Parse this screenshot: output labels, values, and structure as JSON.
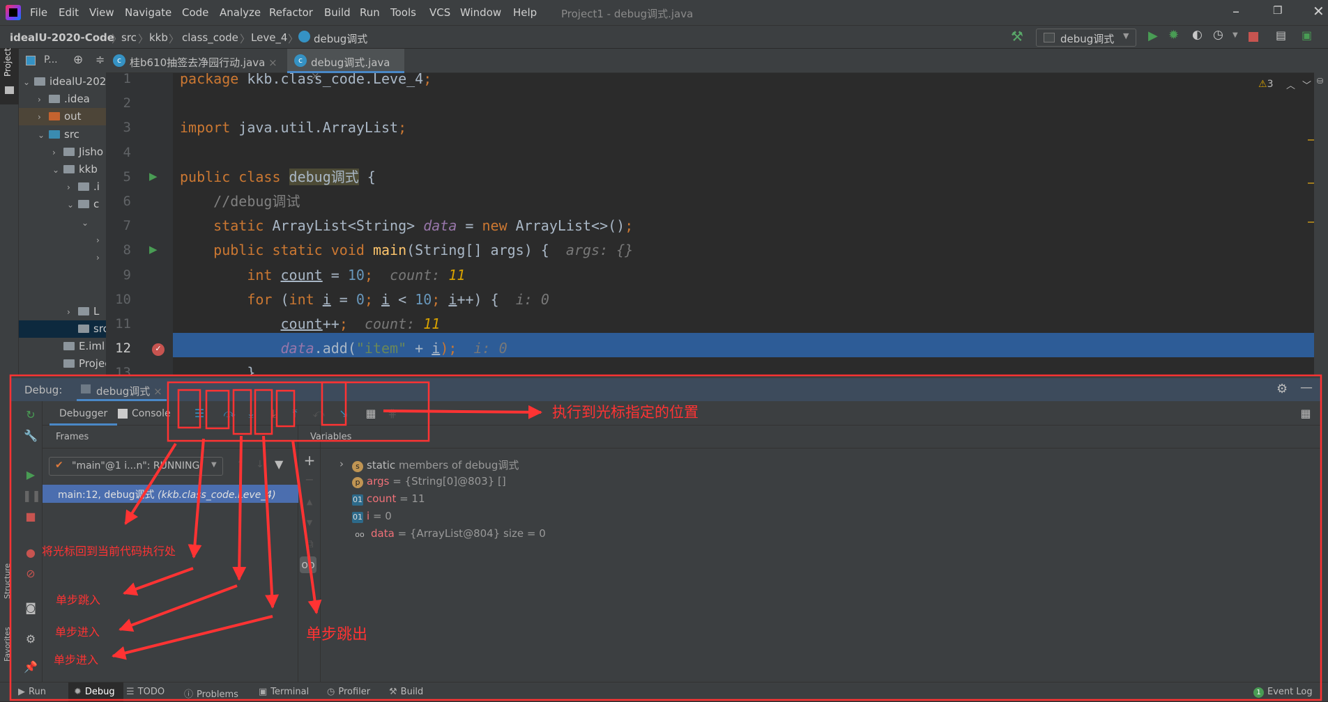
{
  "window": {
    "title": "Project1 - debug调式.java",
    "menu": [
      "File",
      "Edit",
      "View",
      "Navigate",
      "Code",
      "Analyze",
      "Refactor",
      "Build",
      "Run",
      "Tools",
      "VCS",
      "Window",
      "Help"
    ]
  },
  "breadcrumb": [
    "idealU-2020-Code",
    "src",
    "kkb",
    "class_code",
    "Leve_4",
    "debug调式"
  ],
  "run_config": "debug调式",
  "warnings": "3",
  "tabs": [
    {
      "label": "桂b610抽签去净园行动.java"
    },
    {
      "label": "debug调式.java"
    }
  ],
  "project": {
    "panel_label": "P...",
    "stripe_label": "Project",
    "items": [
      {
        "label": "idealU-202",
        "indent": 0,
        "arrow": "v",
        "kind": "module"
      },
      {
        "label": ".idea",
        "indent": 1,
        "arrow": ">",
        "kind": "folder"
      },
      {
        "label": "out",
        "indent": 1,
        "arrow": ">",
        "kind": "out"
      },
      {
        "label": "src",
        "indent": 1,
        "arrow": "v",
        "kind": "src"
      },
      {
        "label": "Jisho",
        "indent": 2,
        "arrow": ">",
        "kind": "pkg"
      },
      {
        "label": "kkb",
        "indent": 2,
        "arrow": "v",
        "kind": "pkg"
      },
      {
        "label": ".i",
        "indent": 3,
        "arrow": ">",
        "kind": "folder"
      },
      {
        "label": "c",
        "indent": 3,
        "arrow": "v",
        "kind": "pkg"
      },
      {
        "label": "",
        "indent": 4,
        "arrow": "v",
        "kind": "none"
      },
      {
        "label": "",
        "indent": 5,
        "arrow": ">",
        "kind": "none"
      },
      {
        "label": "",
        "indent": 5,
        "arrow": ">",
        "kind": "none"
      },
      {
        "label": "L",
        "indent": 3,
        "arrow": ">",
        "kind": "pkg"
      },
      {
        "label": "src.iml",
        "indent": 3,
        "arrow": "",
        "kind": "file"
      },
      {
        "label": "E.iml",
        "indent": 2,
        "arrow": "",
        "kind": "file"
      },
      {
        "label": "Project",
        "indent": 2,
        "arrow": "",
        "kind": "file"
      }
    ]
  },
  "code": {
    "current_line": 12,
    "breakpoint_line": 12,
    "lines": [
      [
        {
          "t": "package ",
          "c": "k"
        },
        {
          "t": "kkb.class_code.Leve_4",
          "c": ""
        },
        {
          "t": ";",
          "c": "k"
        }
      ],
      [],
      [
        {
          "t": "import ",
          "c": "k"
        },
        {
          "t": "java.util.ArrayList",
          "c": ""
        },
        {
          "t": ";",
          "c": "k"
        }
      ],
      [],
      [
        {
          "t": "public class ",
          "c": "k"
        },
        {
          "t": "debug调式",
          "c": "cls"
        },
        {
          "t": " {",
          "c": ""
        }
      ],
      [
        {
          "t": "    //debug调试",
          "c": "c"
        }
      ],
      [
        {
          "t": "    static ",
          "c": "k"
        },
        {
          "t": "ArrayList<String> ",
          "c": ""
        },
        {
          "t": "data",
          "c": "f"
        },
        {
          "t": " = ",
          "c": ""
        },
        {
          "t": "new ",
          "c": "k"
        },
        {
          "t": "ArrayList<>()",
          "c": ""
        },
        {
          "t": ";",
          "c": "k"
        }
      ],
      [
        {
          "t": "    public static void ",
          "c": "k"
        },
        {
          "t": "main",
          "c": "m"
        },
        {
          "t": "(String[] args) {  ",
          "c": ""
        },
        {
          "t": "args: {}",
          "c": "h"
        }
      ],
      [
        {
          "t": "        int ",
          "c": "k"
        },
        {
          "t": "count",
          "c": "u"
        },
        {
          "t": " = ",
          "c": ""
        },
        {
          "t": "10",
          "c": "n"
        },
        {
          "t": ";  ",
          "c": "k"
        },
        {
          "t": "count: ",
          "c": "h"
        },
        {
          "t": "11",
          "c": "hv"
        }
      ],
      [
        {
          "t": "        for ",
          "c": "k"
        },
        {
          "t": "(",
          "c": ""
        },
        {
          "t": "int ",
          "c": "k"
        },
        {
          "t": "i",
          "c": "u"
        },
        {
          "t": " = ",
          "c": ""
        },
        {
          "t": "0",
          "c": "n"
        },
        {
          "t": "; ",
          "c": "k"
        },
        {
          "t": "i",
          "c": "u"
        },
        {
          "t": " < ",
          "c": ""
        },
        {
          "t": "10",
          "c": "n"
        },
        {
          "t": "; ",
          "c": "k"
        },
        {
          "t": "i",
          "c": "u"
        },
        {
          "t": "++) {  ",
          "c": ""
        },
        {
          "t": "i: 0",
          "c": "h"
        }
      ],
      [
        {
          "t": "            ",
          "c": ""
        },
        {
          "t": "count",
          "c": "u"
        },
        {
          "t": "++",
          "c": ""
        },
        {
          "t": ";  ",
          "c": "k"
        },
        {
          "t": "count: ",
          "c": "h"
        },
        {
          "t": "11",
          "c": "hv"
        }
      ],
      [
        {
          "t": "            ",
          "c": ""
        },
        {
          "t": "data",
          "c": "f"
        },
        {
          "t": ".add(",
          "c": ""
        },
        {
          "t": "\"item\"",
          "c": "s"
        },
        {
          "t": " + ",
          "c": ""
        },
        {
          "t": "i",
          "c": "u"
        },
        {
          "t": ");  ",
          "c": "k"
        },
        {
          "t": "i: 0",
          "c": "h"
        }
      ],
      [
        {
          "t": "        }",
          "c": ""
        }
      ]
    ]
  },
  "debug": {
    "label": "Debug:",
    "session": "debug调式",
    "tabs": [
      "Debugger",
      "Console"
    ],
    "frames_label": "Frames",
    "variables_label": "Variables",
    "thread": "\"main\"@1 i...n\": RUNNING",
    "frame": "main:12, debug调式",
    "frame_pkg": "(kkb.class_code.Leve_4)",
    "variables": [
      {
        "badge": "s",
        "name": "static",
        "rest": " members of debug调式",
        "color": "#c09553",
        "expandable": true
      },
      {
        "badge": "p",
        "name": "args",
        "rest": " = {String[0]@803} []",
        "color": "#c09553"
      },
      {
        "badge": "01",
        "name": "count",
        "rest": " = 11",
        "color": "#3592c4"
      },
      {
        "badge": "01",
        "name": "i",
        "rest": " = 0",
        "color": "#3592c4"
      },
      {
        "badge": "oo",
        "name": "data",
        "rest": " = {ArrayList@804}  size = 0",
        "color": ""
      }
    ]
  },
  "bottom": {
    "tools": [
      "Run",
      "Debug",
      "TODO",
      "Problems",
      "Terminal",
      "Profiler",
      "Build"
    ],
    "event_log": "Event Log",
    "event_count": "1",
    "side_labels": [
      "Structure",
      "Favorites"
    ]
  },
  "annotations": {
    "run_to_cursor": "执行到光标指定的位置",
    "show_exec_point": "将光标回到当前代码执行处",
    "step_over": "单步跳入",
    "step_into": "单步进入",
    "force_step_into": "单步进入",
    "step_out": "单步跳出",
    "color": "#ff3333"
  }
}
